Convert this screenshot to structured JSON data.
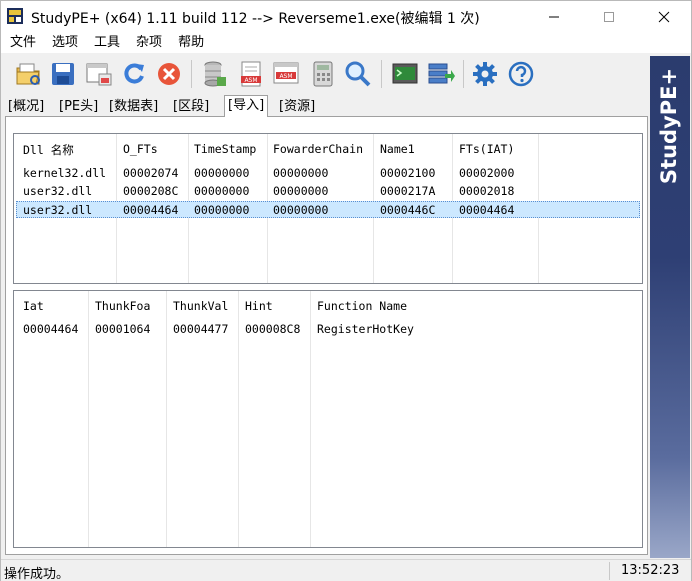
{
  "window": {
    "title": "StudyPE+ (x64) 1.11 build 112  --> Reverseme1.exe(被编辑 1 次)",
    "controls": [
      "minimize",
      "maximize",
      "close"
    ]
  },
  "menu": [
    "文件",
    "选项",
    "工具",
    "杂项",
    "帮助"
  ],
  "toolbar": {
    "buttons": [
      {
        "icon": "open-folder-icon"
      },
      {
        "icon": "save-disk-icon"
      },
      {
        "icon": "window-view-icon"
      },
      {
        "icon": "refresh-icon"
      },
      {
        "icon": "close-circle-icon"
      },
      {
        "icon": "database-icon"
      },
      {
        "icon": "asm-document-icon",
        "label": "ASM"
      },
      {
        "icon": "asm-window-icon",
        "label": "ASM"
      },
      {
        "icon": "calculator-icon"
      },
      {
        "icon": "search-magnifier-icon"
      },
      {
        "icon": "terminal-icon"
      },
      {
        "icon": "export-stack-icon"
      },
      {
        "icon": "gear-icon"
      },
      {
        "icon": "help-icon"
      }
    ]
  },
  "tabs": [
    {
      "label": "[概况]",
      "active": false
    },
    {
      "label": "[PE头]",
      "active": false
    },
    {
      "label": "[数据表]",
      "active": false
    },
    {
      "label": "[区段]",
      "active": false
    },
    {
      "label": "[导入]",
      "active": true
    },
    {
      "label": "[资源]",
      "active": false
    }
  ],
  "dll_table": {
    "columns": [
      "Dll 名称",
      "O_FTs",
      "TimeStamp",
      "FowarderChain",
      "Name1",
      "FTs(IAT)"
    ],
    "rows": [
      [
        "kernel32.dll",
        "00002074",
        "00000000",
        "00000000",
        "00002100",
        "00002000"
      ],
      [
        "user32.dll",
        "0000208C",
        "00000000",
        "00000000",
        "0000217A",
        "00002018"
      ],
      [
        "user32.dll",
        "00004464",
        "00000000",
        "00000000",
        "0000446C",
        "00004464"
      ]
    ],
    "selected_row": 2
  },
  "func_table": {
    "columns": [
      "Iat",
      "ThunkFoa",
      "ThunkVal",
      "Hint",
      "Function Name"
    ],
    "rows": [
      [
        "00004464",
        "00001064",
        "00004477",
        "000008C8",
        "RegisterHotKey"
      ]
    ]
  },
  "banner": {
    "text": "StudyPE+"
  },
  "status": {
    "message": "操作成功。",
    "time": "13:52:23"
  },
  "colors": {
    "selection": "#cce8ff",
    "banner": "#2e3f74",
    "accent_blue": "#1e6fc8"
  }
}
